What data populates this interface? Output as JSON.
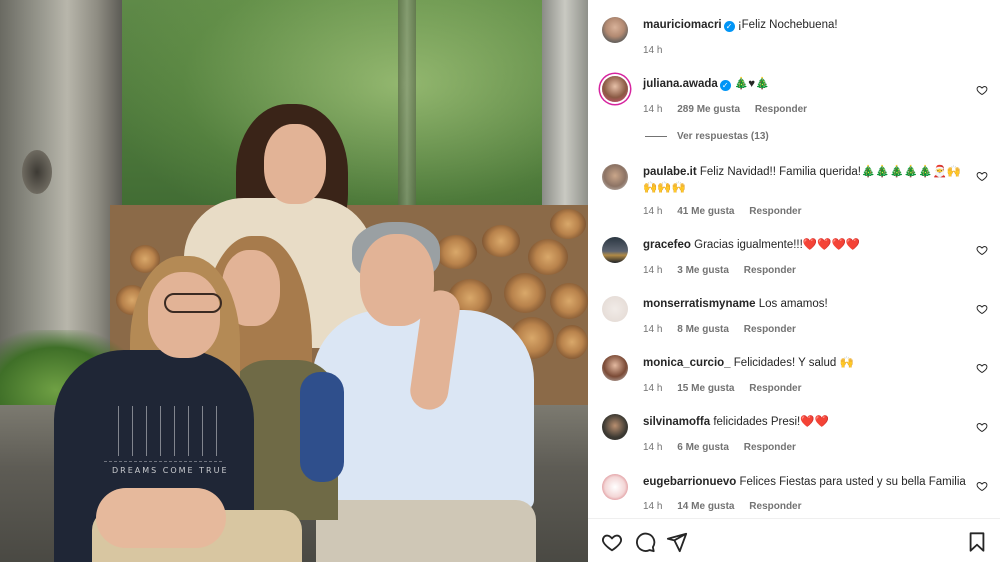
{
  "photo": {
    "shirt_text": "DREAMS COME TRUE"
  },
  "post": {
    "author": "mauriciomacri",
    "caption": "¡Feliz Nochebuena!",
    "time": "14 h"
  },
  "comments": [
    {
      "user": "juliana.awada",
      "verified": true,
      "text": "🎄♥🎄",
      "time": "14 h",
      "likes": "289 Me gusta",
      "reply": "Responder",
      "view_replies": "Ver respuestas (13)"
    },
    {
      "user": "paulabe.it",
      "verified": false,
      "text": "Feliz Navidad!! Familia querida!🎄🎄🎄🎄🎄🎅🙌🙌🙌🙌",
      "time": "14 h",
      "likes": "41 Me gusta",
      "reply": "Responder"
    },
    {
      "user": "gracefeo",
      "verified": false,
      "text": "Gracias igualmente!!!❤️❤️❤️❤️",
      "time": "14 h",
      "likes": "3 Me gusta",
      "reply": "Responder"
    },
    {
      "user": "monserratismyname",
      "verified": false,
      "text": "Los amamos!",
      "time": "14 h",
      "likes": "8 Me gusta",
      "reply": "Responder"
    },
    {
      "user": "monica_curcio_",
      "verified": false,
      "text": "Felicidades! Y salud 🙌",
      "time": "14 h",
      "likes": "15 Me gusta",
      "reply": "Responder"
    },
    {
      "user": "silvinamoffa",
      "verified": false,
      "text": "felicidades Presi!❤️❤️",
      "time": "14 h",
      "likes": "6 Me gusta",
      "reply": "Responder"
    },
    {
      "user": "eugebarrionuevo",
      "verified": false,
      "text": "Felices Fiestas para usted y su bella Familia",
      "time": "14 h",
      "likes": "14 Me gusta",
      "reply": "Responder"
    }
  ],
  "icons": {
    "verified": "verified-badge-icon",
    "like_comment": "heart-outline-icon",
    "toolbar": [
      "heart-outline-icon",
      "comment-bubble-icon",
      "share-plane-icon",
      "bookmark-icon"
    ]
  },
  "colors": {
    "verified": "#0095f6",
    "text_primary": "#262626",
    "text_secondary": "#737373",
    "divider": "#efefef",
    "story_ring": "#d6249f"
  }
}
